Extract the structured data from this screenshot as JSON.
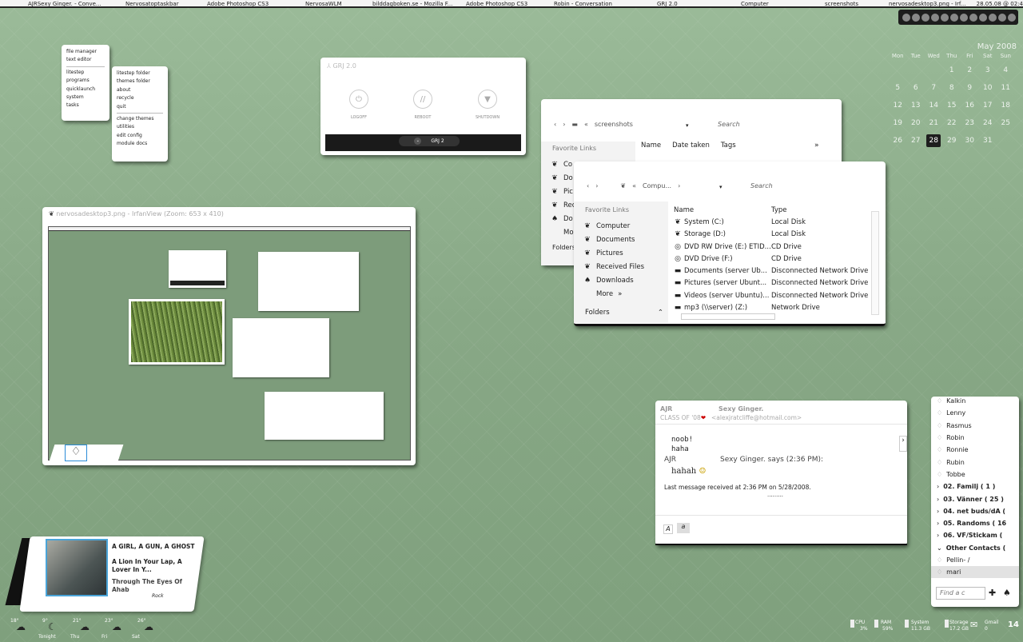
{
  "taskbar": {
    "items": [
      "AJRSexy Ginger. - Conve...",
      "Nervosatoptaskbar",
      "Adobe Photoshop CS3",
      "NervosaWLM",
      "bilddagboken.se - Mozilla F...",
      "Adobe Photoshop CS3",
      "Robin - Conversation",
      "GRJ 2.0",
      "Computer",
      "screenshots",
      "nervosadesktop3.png - Irf..."
    ],
    "clock": "28.05.08 @ 02:4"
  },
  "calendar": {
    "month": "May 2008",
    "dows": [
      "Mon",
      "Tue",
      "Wed",
      "Thu",
      "Fri",
      "Sat",
      "Sun"
    ],
    "weeks": [
      [
        "",
        "",
        "",
        "1",
        "2",
        "3",
        "4"
      ],
      [
        "5",
        "6",
        "7",
        "8",
        "9",
        "10",
        "11"
      ],
      [
        "12",
        "13",
        "14",
        "15",
        "16",
        "17",
        "18"
      ],
      [
        "19",
        "20",
        "21",
        "22",
        "23",
        "24",
        "25"
      ],
      [
        "26",
        "27",
        "28",
        "29",
        "30",
        "31",
        ""
      ]
    ],
    "today": "28"
  },
  "menu1": {
    "top": [
      "file manager",
      "text editor"
    ],
    "bottom": [
      "litestep",
      "programs",
      "quicklaunch",
      "system",
      "tasks"
    ]
  },
  "menu2": {
    "top": [
      "litestep folder",
      "themes folder",
      "about",
      "recycle",
      "quit"
    ],
    "bottom": [
      "change themes",
      "utilities",
      "edit config",
      "module docs"
    ]
  },
  "grj": {
    "title": "GRJ 2.0",
    "buttons": [
      "LOGOFF",
      "REBOOT",
      "SHUTDOWN"
    ],
    "bar": "GRJ 2"
  },
  "exp1": {
    "path": "screenshots",
    "search": "Search",
    "favorites": "Favorite Links",
    "cols": [
      "Name",
      "Date taken",
      "Tags"
    ],
    "items": [
      "Co",
      "Do",
      "Pic",
      "Rec",
      "Do",
      "Mo"
    ],
    "folders": "Folders"
  },
  "exp2": {
    "path": "Compu...",
    "search": "Search",
    "favorites": "Favorite Links",
    "links": [
      "Computer",
      "Documents",
      "Pictures",
      "Received Files",
      "Downloads",
      "More"
    ],
    "folders": "Folders",
    "cols": [
      "Name",
      "Type"
    ],
    "rows": [
      [
        "System (C:)",
        "Local Disk"
      ],
      [
        "Storage (D:)",
        "Local Disk"
      ],
      [
        "DVD RW Drive (E:) ETID...",
        "CD Drive"
      ],
      [
        "DVD Drive (F:)",
        "CD Drive"
      ],
      [
        "Documents (server Ub...",
        "Disconnected Network Drive"
      ],
      [
        "Pictures (server Ubunt...",
        "Disconnected Network Drive"
      ],
      [
        "Videos (server Ubuntu)...",
        "Disconnected Network Drive"
      ],
      [
        "mp3 (\\\\server) (Z:)",
        "Network Drive"
      ]
    ]
  },
  "irfan": {
    "title": "nervosadesktop3.png - IrfanView (Zoom: 653 x 410)"
  },
  "chat": {
    "from": "AJR",
    "class": "CLASS OF '08",
    "to": "Sexy Ginger.",
    "email": "<alexjratcliffe@hotmail.com>",
    "lines": [
      "noob!",
      "haha"
    ],
    "sender": "AJR",
    "says": "Sexy Ginger. says (2:36 PM):",
    "msg": "hahah",
    "last": "Last message received at 2:36 PM on 5/28/2008.",
    "dots": "........."
  },
  "contacts": {
    "people": [
      "Kalkin",
      "Lenny",
      "Rasmus",
      "Robin",
      "Ronnie",
      "Rubin",
      "Tobbe"
    ],
    "groups": [
      "02. Familj ( 1 )",
      "03. Vänner ( 25 )",
      "04. net buds/dA (",
      "05. Randoms ( 16",
      "06. VF/Stickam (",
      "Other Contacts ("
    ],
    "more": [
      "Pellin- /",
      "mari"
    ],
    "find": "Find a c"
  },
  "music": {
    "album": "A GIRL, A GUN, A GHOST",
    "track": "A Lion In Your Lap, A Lover In Y...",
    "artist": "Through The Eyes Of Ahab",
    "genre": "Rock"
  },
  "weather": {
    "temps": [
      "18°",
      "9°",
      "21°",
      "23°",
      "26°"
    ],
    "days": [
      "Tonight",
      "Thu",
      "Fri",
      "Sat"
    ]
  },
  "stats": {
    "labels": [
      "CPU",
      "RAM",
      "System",
      "Storage",
      "Gmail"
    ],
    "values": [
      "3%",
      "59%",
      "11.3 GB",
      "17.2 GB",
      "0"
    ],
    "time": "14"
  }
}
